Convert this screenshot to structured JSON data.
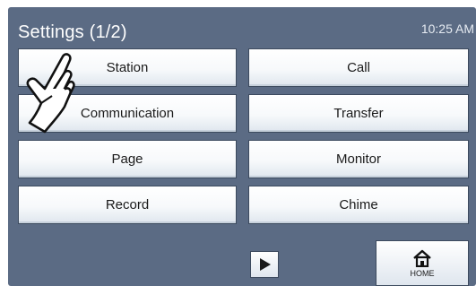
{
  "header": {
    "title": "Settings (1/2)",
    "time": "10:25 AM"
  },
  "menu": {
    "left": [
      "Station",
      "Communication",
      "Page",
      "Record"
    ],
    "right": [
      "Call",
      "Transfer",
      "Monitor",
      "Chime"
    ]
  },
  "footer": {
    "next_icon": "play-triangle-icon",
    "home_label": "HOME",
    "home_icon": "home-icon"
  },
  "overlay": {
    "pointer_icon": "hand-pointer-icon"
  },
  "colors": {
    "screen_bg": "#5b6b84",
    "button_border": "#3c4a5e",
    "button_top": "#ffffff",
    "button_bottom": "#dfe6ee"
  }
}
